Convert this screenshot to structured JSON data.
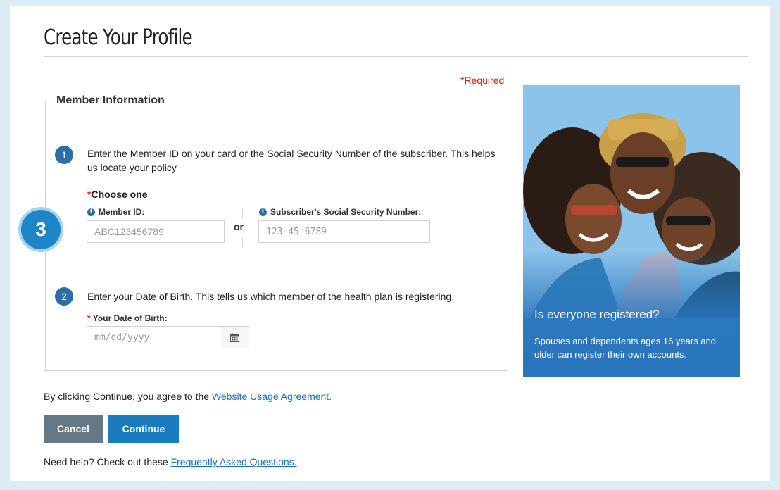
{
  "header": {
    "title": "Create Your Profile",
    "required_note": "*Required"
  },
  "member_info": {
    "legend": "Member Information",
    "step1": {
      "number": "1",
      "text": "Enter the Member ID on your card or the Social Security Number of the subscriber. This helps us locate your policy",
      "choose_star": "*",
      "choose_label": "Choose one",
      "member_id_label": "Member ID:",
      "member_id_placeholder": "ABC123456789",
      "or_label": "or",
      "ssn_label": "Subscriber's Social Security Number:",
      "ssn_placeholder": "123-45-6789"
    },
    "step2": {
      "number": "2",
      "text": "Enter your Date of Birth. This tells us which member of the health plan is registering.",
      "dob_star": "*",
      "dob_label": "Your Date of Birth:",
      "dob_placeholder": "mm/dd/yyyy"
    }
  },
  "callout_badge": "3",
  "promo": {
    "title": "Is everyone registered?",
    "text": "Spouses and dependents ages 16 years and older can register their own accounts."
  },
  "agreement": {
    "prefix": "By clicking Continue, you agree to the ",
    "link": "Website Usage Agreement."
  },
  "buttons": {
    "cancel": "Cancel",
    "continue": "Continue"
  },
  "help": {
    "prefix": "Need help? Check out these ",
    "link": "Frequently Asked Questions."
  },
  "icons": {
    "info": "info-icon",
    "calendar": "calendar-icon"
  },
  "colors": {
    "accent": "#1a7bbf",
    "step": "#2b6ea8",
    "required": "#d0271d",
    "cancel": "#647885"
  }
}
